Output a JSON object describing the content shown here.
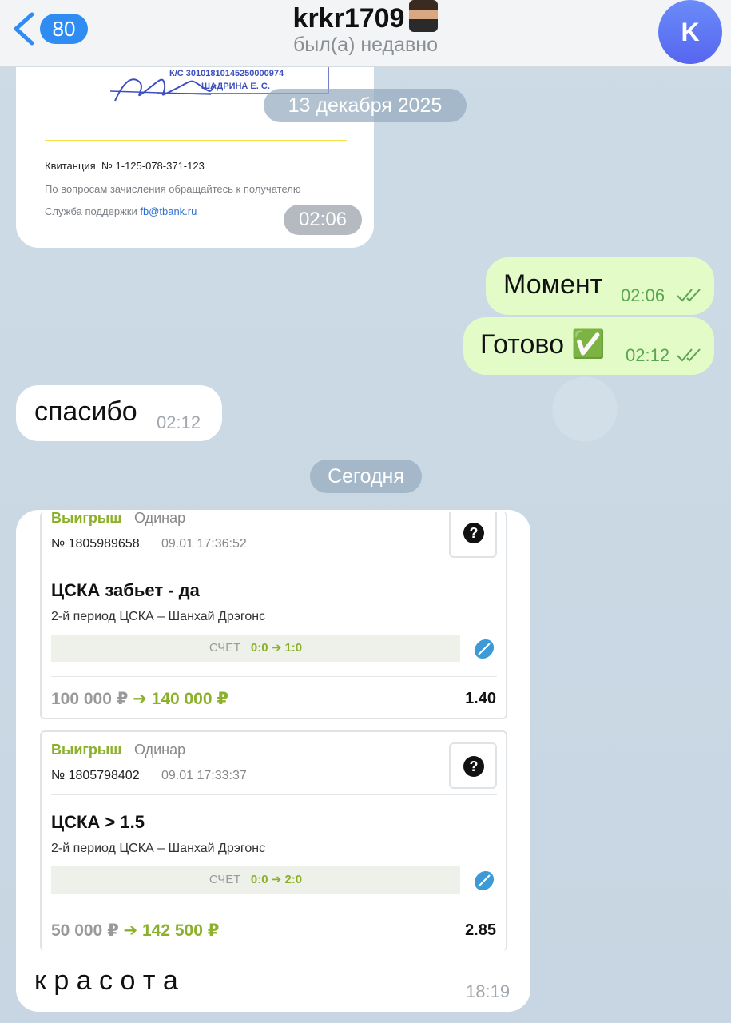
{
  "header": {
    "back_badge": "80",
    "title": "krkr1709",
    "status": "был(а) недавно",
    "avatar_letter": "K",
    "accent": "#2f8cf3"
  },
  "receipt": {
    "stamp_line1": "К/С 30101810145250000974",
    "stamp_line2": "ШАДРИНА Е. С.",
    "receipt_label": "Квитанция",
    "receipt_number": "№ 1-125-078-371-123",
    "questions": "По вопросам зачисления обращайтесь к получателю",
    "support_label": "Служба поддержки",
    "support_email": "fb@tbank.ru",
    "time": "02:06"
  },
  "date_divider_1": "13 декабря 2025",
  "messages": {
    "moment": {
      "text": "Момент",
      "time": "02:06"
    },
    "gotovo": {
      "text": "Готово ✅",
      "time": "02:12"
    },
    "spasibo": {
      "text": "спасибо",
      "time": "02:12"
    }
  },
  "date_divider_2": "Сегодня",
  "bets": [
    {
      "status": "Выигрыш",
      "type": "Одинар",
      "number": "№ 1805989658",
      "datetime": "09.01 17:36:52",
      "title": "ЦСКА забьет - да",
      "period": "2-й период ЦСКА – Шанхай Дрэгонс",
      "score_label": "СЧЕТ",
      "score_value": "0:0 ➔ 1:0",
      "stake": "100 000 ₽",
      "payout": "➔ 140 000 ₽",
      "coef": "1.40"
    },
    {
      "status": "Выигрыш",
      "type": "Одинар",
      "number": "№ 1805798402",
      "datetime": "09.01 17:33:37",
      "title": "ЦСКА > 1.5",
      "period": "2-й период ЦСКА – Шанхай Дрэгонс",
      "score_label": "СЧЕТ",
      "score_value": "0:0 ➔ 2:0",
      "stake": "50 000 ₽",
      "payout": "➔ 142 500 ₽",
      "coef": "2.85"
    }
  ],
  "caption": {
    "text": "к р а с о т а",
    "time": "18:19"
  }
}
